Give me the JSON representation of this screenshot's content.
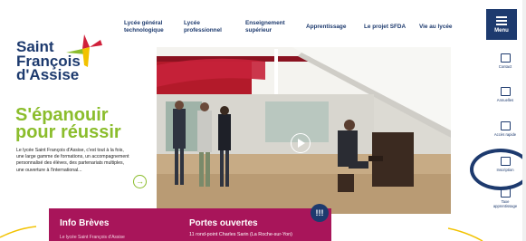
{
  "logo": {
    "line1": "Saint",
    "line2": "François",
    "line3": "d'Assise"
  },
  "nav": {
    "items": [
      {
        "label": "Lycée général\ntechnologique"
      },
      {
        "label": "Lycée\nprofessionnel"
      },
      {
        "label": "Enseignement\nsupérieur"
      },
      {
        "label": "Apprentissage"
      },
      {
        "label": "Le projet SFDA"
      },
      {
        "label": "Vie au lycée"
      }
    ]
  },
  "hero": {
    "title_line1": "S'épanouir",
    "title_line2": "pour réussir",
    "description": "Le lycée Saint François d'Assise, c'est tout à la fois, une large gamme de formations, un accompagnement personnalisé des élèves, des partenariats multiples, une ouverture à l'international..."
  },
  "sidebar": {
    "menu_label": "Menu",
    "items": [
      {
        "label": "Contact",
        "icon": "mail-icon"
      },
      {
        "label": "Annuelles",
        "icon": "calendar-icon"
      },
      {
        "label": "Accès rapide",
        "icon": "login-icon"
      },
      {
        "label": "Inscription",
        "icon": "inscription-icon"
      },
      {
        "label": "Taxe\napprentissage",
        "icon": "document-icon"
      }
    ]
  },
  "bottom": {
    "info_title": "Info Brèves",
    "info_sub": "Le lycée Saint François d'Assise",
    "portes_title": "Portes ouvertes",
    "portes_sub": "11 rond-point Charles Sarin (La Roche-sur-Yon)",
    "badge": "!!!"
  },
  "colors": {
    "navy": "#1d3a6e",
    "green": "#8bbd2c",
    "magenta": "#a8155a",
    "yellow": "#f2c200",
    "red": "#d0203a"
  }
}
